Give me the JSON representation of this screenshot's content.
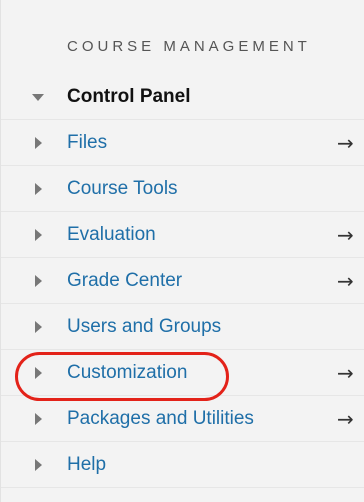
{
  "section_title": "COURSE MANAGEMENT",
  "items": [
    {
      "label": "Control Panel",
      "expanded": true,
      "arrow": ""
    },
    {
      "label": "Files",
      "expanded": false,
      "arrow": "→"
    },
    {
      "label": "Course Tools",
      "expanded": false,
      "arrow": ""
    },
    {
      "label": "Evaluation",
      "expanded": false,
      "arrow": "→"
    },
    {
      "label": "Grade Center",
      "expanded": false,
      "arrow": "→"
    },
    {
      "label": "Users and Groups",
      "expanded": false,
      "arrow": ""
    },
    {
      "label": "Customization",
      "expanded": false,
      "arrow": "→"
    },
    {
      "label": "Packages and Utilities",
      "expanded": false,
      "arrow": "→"
    },
    {
      "label": "Help",
      "expanded": false,
      "arrow": ""
    }
  ],
  "colors": {
    "link": "#1f6fa8",
    "highlight": "#e32219"
  },
  "annotation": {
    "highlighted_item": "Customization"
  }
}
